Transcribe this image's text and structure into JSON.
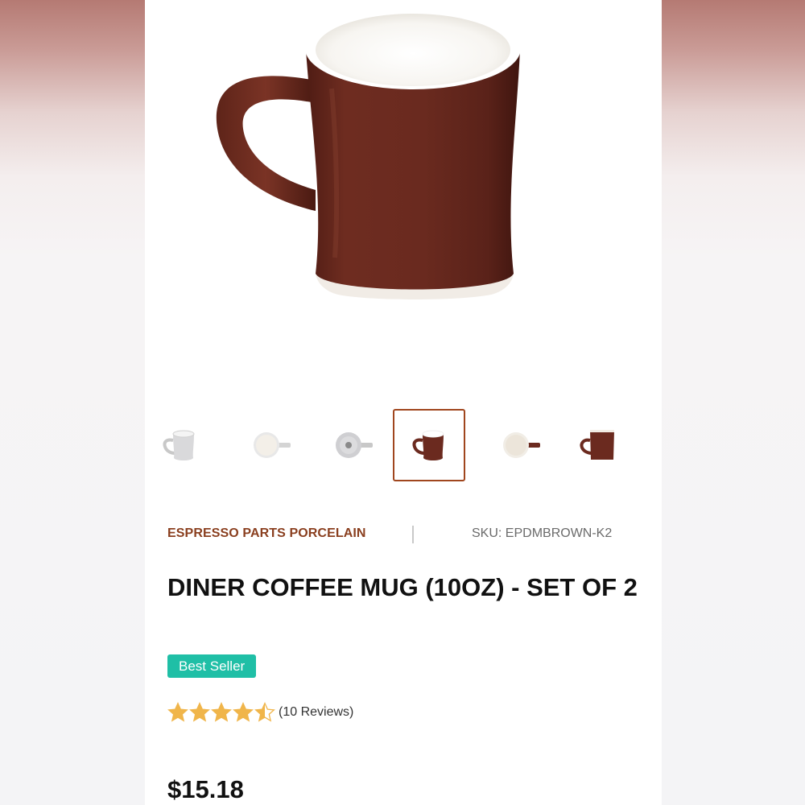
{
  "product": {
    "brand": "ESPRESSO PARTS PORCELAIN",
    "sku": "SKU: EPDMBROWN-K2",
    "title": "DINER COFFEE MUG (10OZ) - SET OF 2",
    "badge": "Best Seller",
    "rating": 4.5,
    "reviews_text": "(10 Reviews)",
    "price": "$15.18"
  },
  "gallery": {
    "selected_index": 3,
    "thumbnails": [
      {
        "icon": "white-mug-side-icon"
      },
      {
        "icon": "white-mug-top-icon"
      },
      {
        "icon": "white-mug-bottom-icon"
      },
      {
        "icon": "brown-mug-side-icon"
      },
      {
        "icon": "brown-mug-top-icon"
      },
      {
        "icon": "brown-mug-front-icon"
      },
      {
        "icon": "brown-mug-partial-icon"
      }
    ]
  },
  "colors": {
    "brand_text": "#8a3f1f",
    "badge_bg": "#1fbfa6",
    "selected_border": "#a0461e",
    "star": "#f0b54a",
    "mug_brown": "#6b2a1f"
  }
}
